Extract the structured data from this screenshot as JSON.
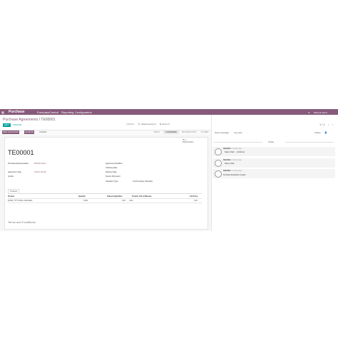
{
  "topbar": {
    "app": "Purchase",
    "menu": [
      "Purchase",
      "Control",
      "Reporting",
      "Configuration"
    ],
    "user": "Mitchell Admin"
  },
  "breadcrumb": {
    "parent": "Purchase Agreements",
    "separator": "/",
    "current": "TE00001"
  },
  "actions": {
    "edit": "EDIT",
    "create": "CREATE"
  },
  "toolbar": {
    "print": "Print",
    "attachments": "Attachment(s)",
    "action": "Action",
    "pager": "1 / 1"
  },
  "buttons": {
    "new_quotation": "NEW QUOTATION",
    "validate": "VALIDATE",
    "cancel": "CANCEL"
  },
  "stages": [
    "DRAFT",
    "CONFIRMED",
    "BID SELECTION",
    "CLOSED"
  ],
  "smart_button": {
    "count": "0",
    "label": "RFQs/Orders"
  },
  "record": {
    "name": "TE00001",
    "fields_left": [
      {
        "label": "Purchase Representative",
        "value": "Mitchell Admin"
      },
      {
        "label": "Agreement Type",
        "value": "Call for Tender"
      },
      {
        "label": "Vendor",
        "value": ""
      }
    ],
    "fields_right": [
      {
        "label": "Agreement Deadline",
        "value": ""
      },
      {
        "label": "Ordering Date",
        "value": ""
      },
      {
        "label": "Delivery Date",
        "value": ""
      },
      {
        "label": "Source Document",
        "value": ""
      },
      {
        "label": "Operation Type",
        "value": "YourCompany: Receipts"
      }
    ]
  },
  "tabs": {
    "products": "Products"
  },
  "table": {
    "headers": [
      "Product",
      "Quantity",
      "Ordered Quantities",
      "Product Unit of Measure",
      "Unit Price"
    ],
    "rows": [
      [
        "[FURN_7777] Office Chair Black",
        "5.000",
        "0.00",
        "Units",
        "0.00"
      ]
    ]
  },
  "terms": "Terms and Conditions",
  "chatter": {
    "send_message": "Send message",
    "log_note": "Log note",
    "follow": "Follow",
    "today": "Today",
    "messages": [
      {
        "author": "OdooBot",
        "time": "2 minutes ago",
        "text": "Status: Draft → Confirmed"
      },
      {
        "author": "OdooBot",
        "time": "2 minutes ago",
        "text": "Status: Draft"
      },
      {
        "author": "OdooBot",
        "time": "2 minutes ago",
        "text": "Purchase Requisition created"
      }
    ]
  }
}
